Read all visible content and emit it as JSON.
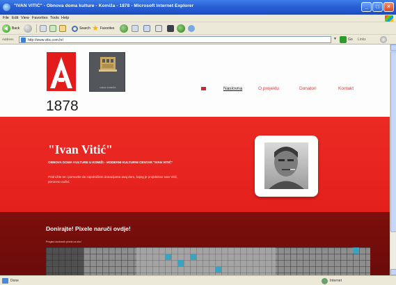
{
  "browser": {
    "title": "\"IVAN VITIĆ\" - Obnova doma kulture - Komiža - 1878 - Microsoft Internet Explorer",
    "menu": [
      "File",
      "Edit",
      "View",
      "Favorites",
      "Tools",
      "Help"
    ],
    "toolbar": {
      "back_label": "Back",
      "search_label": "Search",
      "favorites_label": "Favorites"
    },
    "address": {
      "label": "Address",
      "url": "http://www.vitic.com.hr/",
      "go_label": "Go",
      "links_label": "Links"
    },
    "status": {
      "text": "Done",
      "zone": "Internet"
    }
  },
  "site": {
    "year": "1878",
    "crest_caption": "GRAD KOMIŽA",
    "nav": [
      {
        "label": "Naslovna",
        "active": true
      },
      {
        "label": "O projektu",
        "active": false
      },
      {
        "label": "Donatori",
        "active": false
      },
      {
        "label": "Kontakt",
        "active": false
      }
    ],
    "hero": {
      "title": "\"Ivan Vitić\"",
      "subtitle": "OBNOVA DOMA KULTURE U KOMIŽI - MODERNI KULTURNI CENTAR \"IVAN VITIĆ\"",
      "description": "Pridružite se i pomozite da zajedničkim donacijama ovaj dom, kojeg je projektirao Ivan Vitić, ponovno zaživi."
    },
    "donate": {
      "title": "Donirajte! Pixele naruči ovdje!",
      "mosaic_label": "Pregled doniranih pixela na slici"
    }
  },
  "colors": {
    "brand_red": "#e31b1b",
    "hero_red": "#e8231f",
    "dark_red": "#740e0b",
    "nav_red": "#d83a3a"
  }
}
